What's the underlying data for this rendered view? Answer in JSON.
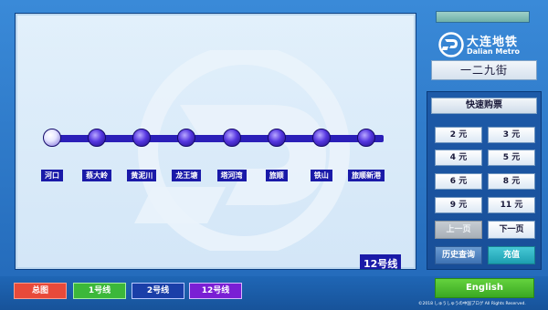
{
  "map": {
    "stations": [
      {
        "name": "河口",
        "current": true
      },
      {
        "name": "蔡大岭",
        "current": false
      },
      {
        "name": "黄泥川",
        "current": false
      },
      {
        "name": "龙王塘",
        "current": false
      },
      {
        "name": "塔河湾",
        "current": false
      },
      {
        "name": "旅顺",
        "current": false
      },
      {
        "name": "铁山",
        "current": false
      },
      {
        "name": "旅顺新港",
        "current": false
      }
    ],
    "line_label": "12号线",
    "line_color": "#2b1fb8"
  },
  "header": {
    "logo_cn": "大连地铁",
    "logo_en": "Dalian Metro",
    "current_station": "一二九街"
  },
  "ticket": {
    "title": "快速购票",
    "fares": [
      "2 元",
      "3 元",
      "4 元",
      "5 元",
      "6 元",
      "8 元",
      "9 元",
      "11 元"
    ],
    "prev_label": "上一页",
    "next_label": "下一页",
    "history_label": "历史查询",
    "recharge_label": "充值"
  },
  "footer": {
    "tabs": [
      {
        "label": "总图",
        "color": "#e84a3a"
      },
      {
        "label": "1号线",
        "color": "#3cb83a"
      },
      {
        "label": "2号线",
        "color": "#1a3fa8"
      },
      {
        "label": "12号线",
        "color": "#7a1fd4"
      }
    ],
    "language_label": "English",
    "copyright": "©2018 しゅうしゅうの中国ブログ All Rights Reserved."
  }
}
